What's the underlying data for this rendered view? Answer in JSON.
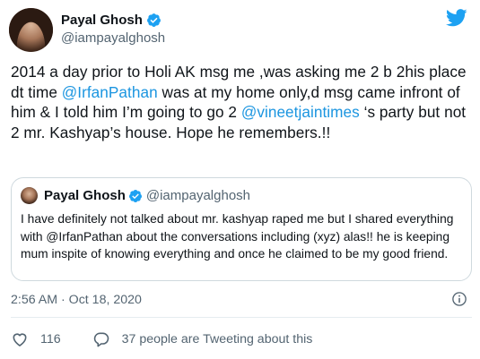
{
  "author": {
    "name": "Payal Ghosh",
    "handle": "@iampayalghosh"
  },
  "tweet": {
    "text_parts": {
      "p1": "2014 a day prior to Holi AK msg me ,was asking me 2 b 2his place dt time ",
      "m1": "@IrfanPathan",
      "p2": " was at my home only,d msg came infront of him & I told him I’m going to go 2 ",
      "m2": "@vineetjaintimes",
      "p3": " ‘s party but not 2 mr. Kashyap’s house. Hope he remembers.!!"
    },
    "timestamp": "2:56 AM · Oct 18, 2020"
  },
  "quoted_tweet": {
    "name": "Payal Ghosh",
    "handle": "@iampayalghosh",
    "text": "I have definitely not talked about mr. kashyap raped me but I shared everything with @IrfanPathan about the conversations including (xyz) alas!! he is keeping mum inspite of knowing everything and once he claimed to be my good friend."
  },
  "actions": {
    "likes": "116",
    "conversation": "37 people are Tweeting about this"
  },
  "colors": {
    "mention": "#1b95e0",
    "twitter_blue": "#1da1f2",
    "like_red": "#e0245e",
    "secondary_text": "#536471"
  },
  "icons": [
    "twitter-bird-icon",
    "verified-badge-icon",
    "info-icon",
    "heart-icon",
    "speech-bubble-icon"
  ]
}
